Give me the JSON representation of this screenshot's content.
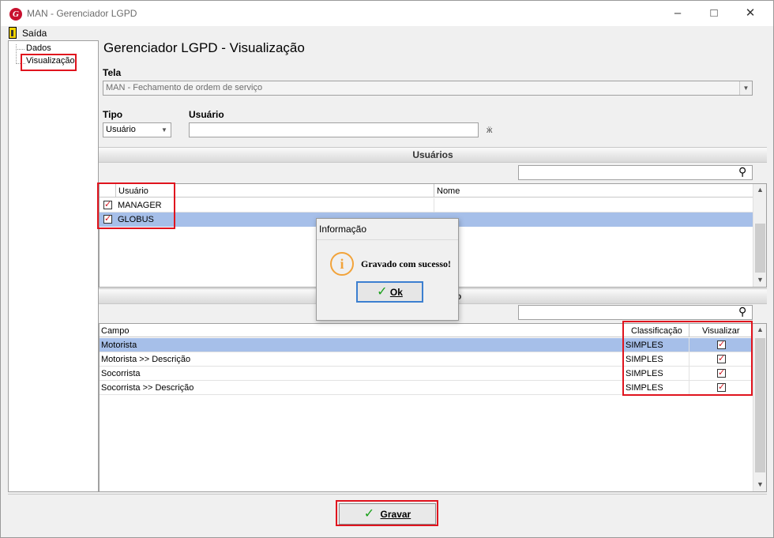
{
  "window": {
    "title": "MAN - Gerenciador LGPD",
    "logo_letter": "G",
    "minimize_icon": "–",
    "maximize_icon": "□",
    "close_icon": "✕"
  },
  "menu": {
    "exit_label": "Saída"
  },
  "tree": {
    "items": [
      {
        "label": "Dados"
      },
      {
        "label": "Visualização"
      }
    ]
  },
  "main": {
    "title": "Gerenciador LGPD - Visualização",
    "tela_label": "Tela",
    "tela_value": "MAN - Fechamento de ordem de serviço",
    "tipo_label": "Tipo",
    "tipo_value": "Usuário",
    "usuario_label": "Usuário",
    "usuario_value": ""
  },
  "users_section": {
    "title": "Usuários",
    "search_value": "",
    "columns": [
      "Usuário",
      "Nome"
    ],
    "rows": [
      {
        "checked": true,
        "usuario": "MANAGER",
        "nome": ""
      },
      {
        "checked": true,
        "usuario": "GLOBUS",
        "nome": ""
      }
    ]
  },
  "fields_section": {
    "title_fragment": "o",
    "search_value": "",
    "columns": [
      "Campo",
      "Classificação",
      "Visualizar"
    ],
    "rows": [
      {
        "campo": "Motorista",
        "classificacao": "SIMPLES",
        "visualizar": true
      },
      {
        "campo": "Motorista >> Descrição",
        "classificacao": "SIMPLES",
        "visualizar": true
      },
      {
        "campo": "Socorrista",
        "classificacao": "SIMPLES",
        "visualizar": true
      },
      {
        "campo": "Socorrista >> Descrição",
        "classificacao": "SIMPLES",
        "visualizar": true
      }
    ]
  },
  "dialog": {
    "title": "Informação",
    "icon": "info-icon",
    "icon_glyph": "i",
    "message": "Gravado com sucesso!",
    "ok_label": "Ok"
  },
  "footer": {
    "save_label": "Gravar"
  },
  "colors": {
    "highlight": "#e0141e",
    "selection": "#a6bfe9",
    "accent_check": "#1aa01a"
  }
}
